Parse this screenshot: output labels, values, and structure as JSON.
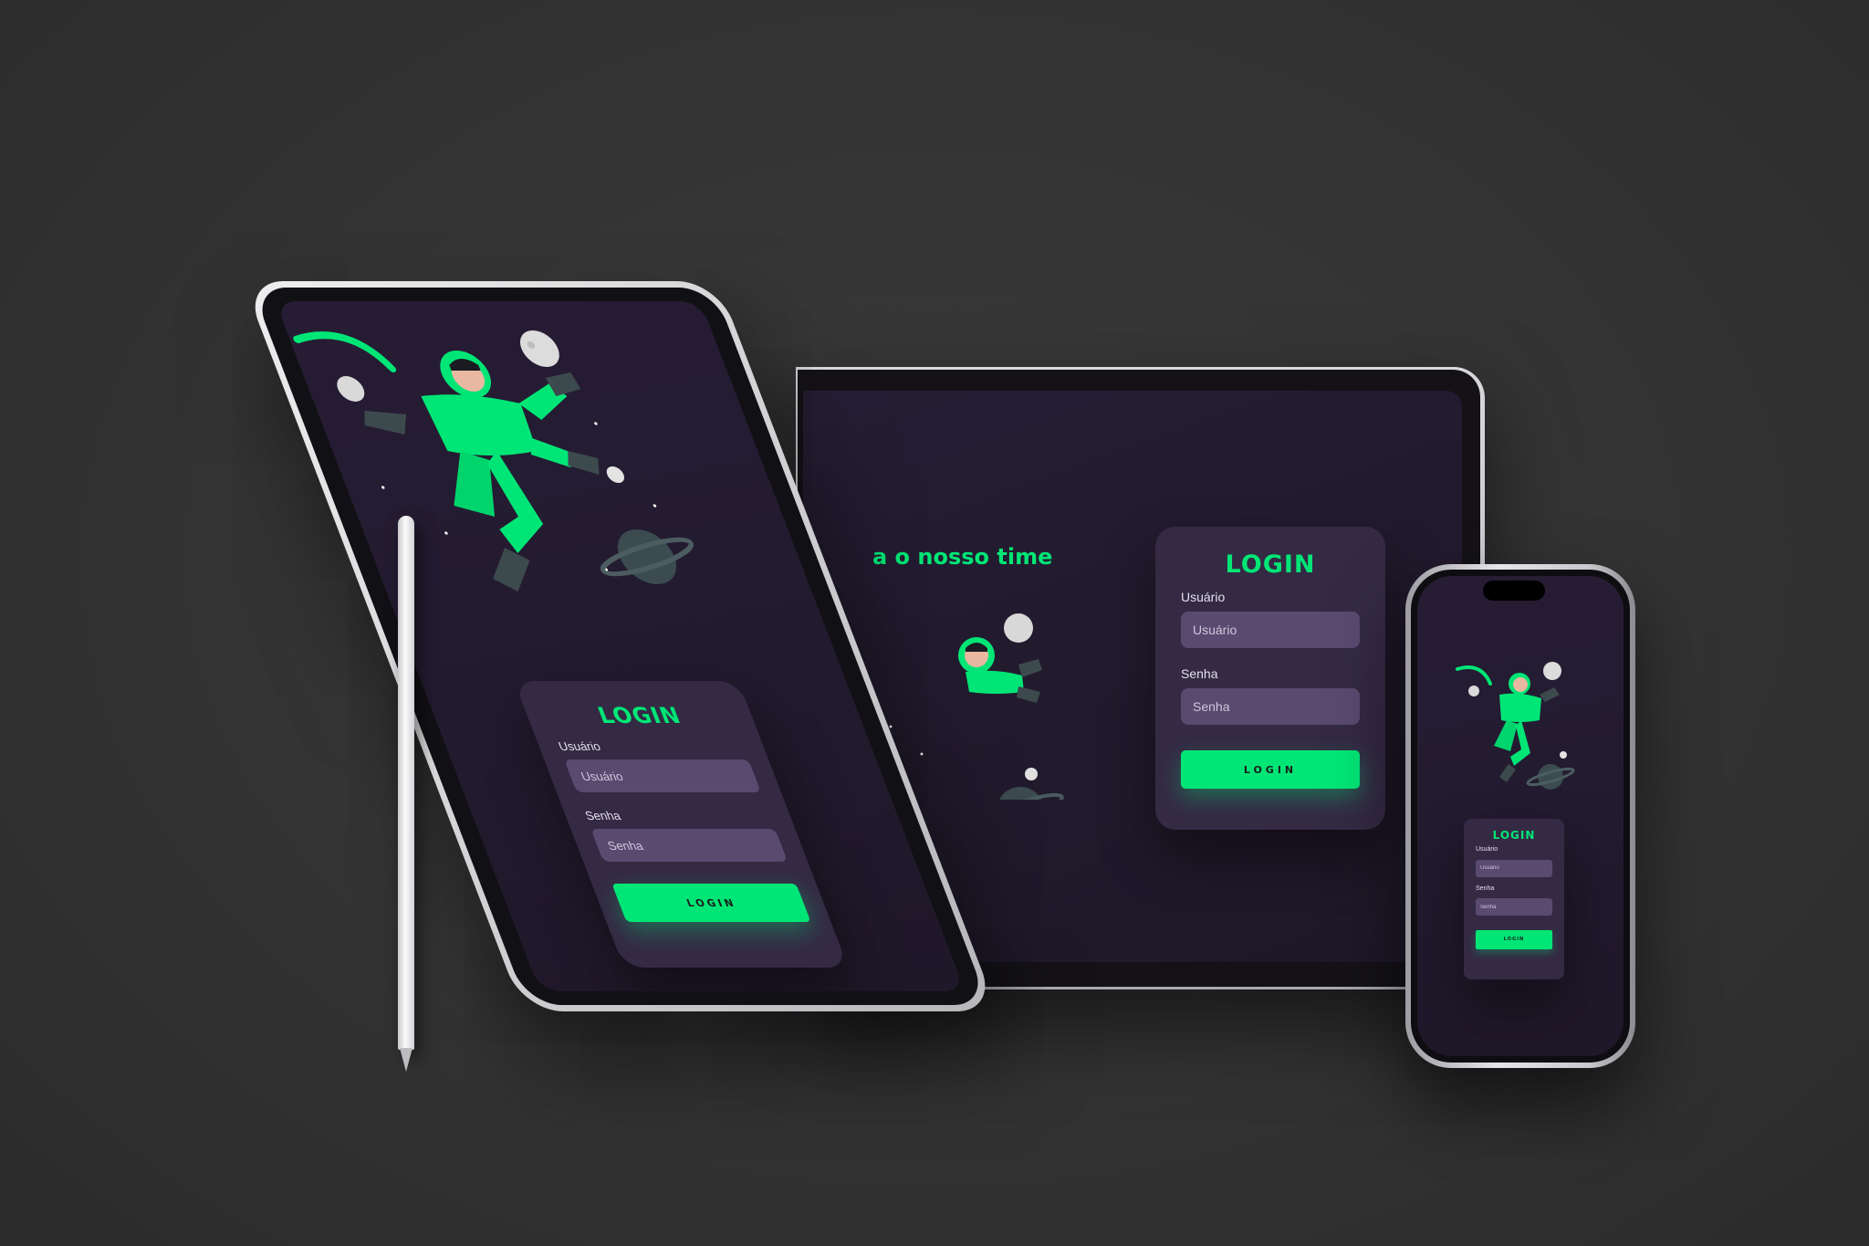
{
  "colors": {
    "accent": "#00e676",
    "screen_bg": "#231b30",
    "card_bg": "#342a44",
    "field_bg": "#5a4a70"
  },
  "laptop": {
    "headline": "a o nosso time",
    "login": {
      "title": "LOGIN",
      "user_label": "Usuário",
      "user_placeholder": "Usuário",
      "pass_label": "Senha",
      "pass_placeholder": "Senha",
      "button": "LOGIN"
    }
  },
  "tablet": {
    "login": {
      "title": "LOGIN",
      "user_label": "Usuário",
      "user_placeholder": "Usuário",
      "pass_label": "Senha",
      "pass_placeholder": "Senha",
      "button": "LOGIN"
    }
  },
  "phone": {
    "login": {
      "title": "LOGIN",
      "user_label": "Usuário",
      "user_placeholder": "Usuário",
      "pass_label": "Senha",
      "pass_placeholder": "Senha",
      "button": "LOGIN"
    }
  },
  "illustration": {
    "icon": "astronaut-illustration"
  }
}
